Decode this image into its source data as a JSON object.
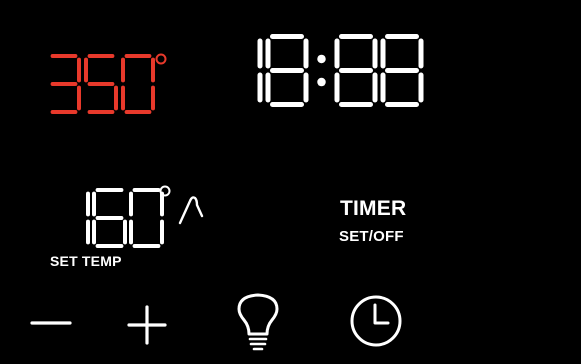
{
  "oven_temp": {
    "value": "350",
    "unit": "°",
    "color": "#e8392b"
  },
  "clock": {
    "value": "18:88",
    "color": "#ffffff"
  },
  "set_temp": {
    "value": "160",
    "unit": "°",
    "label": "SET TEMP",
    "color": "#ffffff"
  },
  "timer": {
    "title": "TIMER",
    "subtitle": "SET/OFF"
  },
  "controls": {
    "decrease": "minus-icon",
    "increase": "plus-icon",
    "light": "lightbulb-icon",
    "timer": "clock-icon",
    "probe": "probe-icon"
  }
}
